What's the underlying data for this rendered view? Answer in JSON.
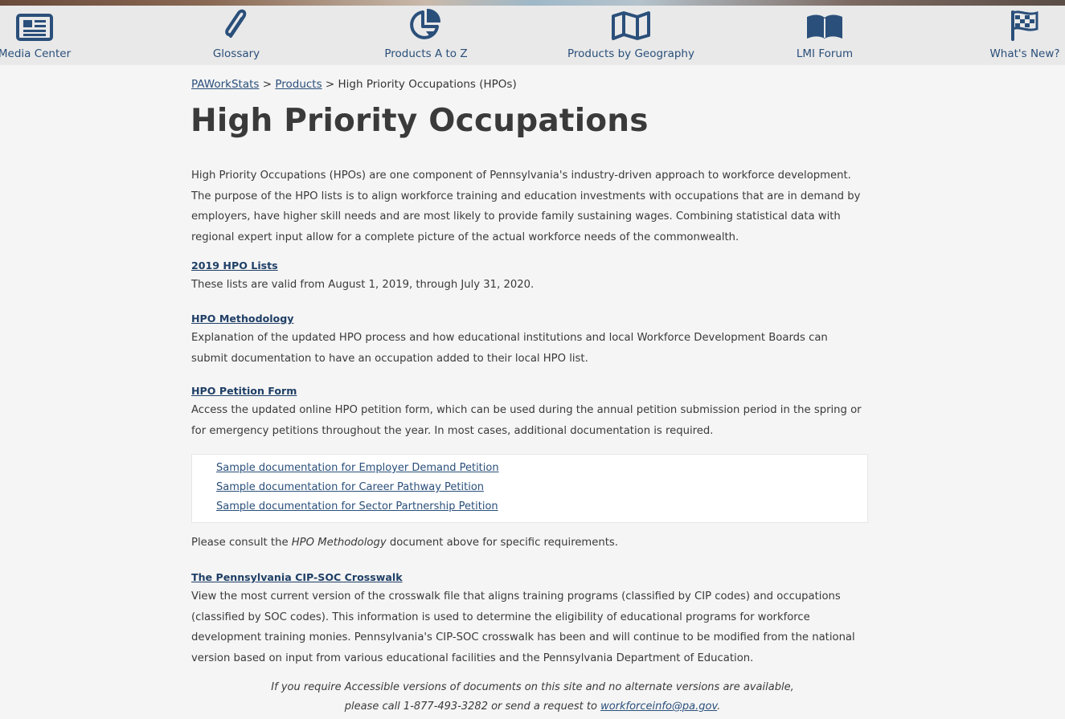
{
  "nav": {
    "items": [
      {
        "label": "Media Center",
        "icon": "newspaper-icon"
      },
      {
        "label": "Glossary",
        "icon": "paperclip-icon"
      },
      {
        "label": "Products A to Z",
        "icon": "pie-chart-icon"
      },
      {
        "label": "Products by Geography",
        "icon": "map-icon"
      },
      {
        "label": "LMI Forum",
        "icon": "book-icon"
      },
      {
        "label": "What's New?",
        "icon": "checkered-flag-icon"
      }
    ]
  },
  "breadcrumb": {
    "home": "PAWorkStats",
    "sep1": " > ",
    "products": "Products",
    "sep2": " >  ",
    "current": "High Priority Occupations (HPOs)"
  },
  "page": {
    "title": "High Priority Occupations",
    "intro": "High Priority Occupations (HPOs) are one component of Pennsylvania's industry-driven approach to workforce development. The purpose of the HPO lists is to align workforce training and education investments with occupations that are in demand by employers, have higher skill needs and are most likely to provide family sustaining wages. Combining statistical data with regional expert input allow for a complete picture of the actual workforce needs of the commonwealth."
  },
  "sections": {
    "lists": {
      "link": "2019 HPO Lists",
      "desc": "These lists are valid from August 1, 2019, through July 31, 2020."
    },
    "methodology": {
      "link": "HPO Methodology",
      "desc": "Explanation of the updated HPO process and how educational institutions and local Workforce Development Boards can submit documentation to have an occupation added to their local HPO list."
    },
    "petition": {
      "link": "HPO Petition Form",
      "desc": "Access the updated online HPO petition form, which can be used during the annual petition submission period in the spring or for emergency petitions throughout the year. In most cases, additional documentation is required."
    },
    "samples": [
      "Sample documentation for Employer Demand Petition",
      "Sample documentation for Career Pathway Petition",
      "Sample documentation for Sector Partnership Petition"
    ],
    "consult": {
      "before": "Please consult the ",
      "em": "HPO Methodology",
      "after": " document above for specific requirements."
    },
    "crosswalk": {
      "link": "The Pennsylvania CIP-SOC Crosswalk",
      "desc": "View the most current version of the crosswalk file that aligns training programs (classified by CIP codes) and occupations (classified by SOC codes). This information is used to determine the eligibility of educational programs for workforce development training monies. Pennsylvania's CIP-SOC crosswalk has been and will continue to be modified from the national version based on input from various educational facilities and the Pennsylvania Department of Education."
    }
  },
  "footer": {
    "line1": "If you require Accessible versions of documents on this site and no alternate versions are available,",
    "line2_before": "please call 1-877-493-3282 or send a request to ",
    "email": "workforceinfo@pa.gov",
    "line2_after": "."
  },
  "colors": {
    "nav_icon": "#2a4f7a",
    "link": "#2a4f7a",
    "section_link": "#1f3f66",
    "nav_bg": "#e9e9e9",
    "page_bg": "#f5f5f5"
  }
}
